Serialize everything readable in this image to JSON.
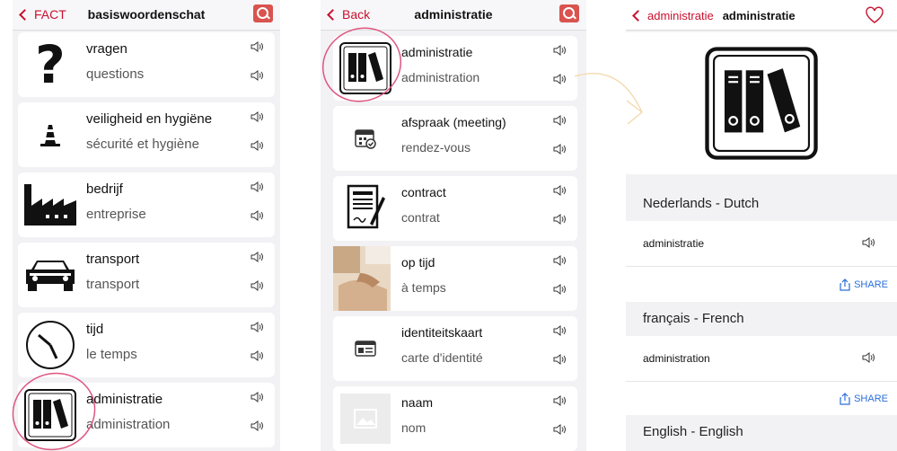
{
  "screen1": {
    "back_label": "FACT",
    "title": "basiswoordenschat",
    "items": [
      {
        "word": "vragen",
        "translation": "questions",
        "icon": "question-mark-icon"
      },
      {
        "word": "veiligheid en hygiëne",
        "translation": "sécurité et hygiène",
        "icon": "traffic-cone-icon"
      },
      {
        "word": "bedrijf",
        "translation": "entreprise",
        "icon": "factory-icon"
      },
      {
        "word": "transport",
        "translation": "transport",
        "icon": "car-icon"
      },
      {
        "word": "tijd",
        "translation": "le temps",
        "icon": "clock-icon"
      },
      {
        "word": "administratie",
        "translation": "administration",
        "icon": "binders-icon"
      }
    ]
  },
  "screen2": {
    "back_label": "Back",
    "title": "administratie",
    "items": [
      {
        "word": "administratie",
        "translation": "administration",
        "icon": "binders-icon"
      },
      {
        "word": "afspraak (meeting)",
        "translation": "rendez-vous",
        "icon": "calendar-icon"
      },
      {
        "word": "contract",
        "translation": "contrat",
        "icon": "contract-icon"
      },
      {
        "word": "op tijd",
        "translation": "à temps",
        "icon": "photo-handshake-icon"
      },
      {
        "word": "identiteitskaart",
        "translation": "carte d'identité",
        "icon": "id-card-icon"
      },
      {
        "word": "naam",
        "translation": "nom",
        "icon": "image-placeholder-icon"
      }
    ]
  },
  "screen3": {
    "back_label": "administratie",
    "title": "administratie",
    "sections": [
      {
        "header": "Nederlands - Dutch",
        "word": "administratie",
        "share_label": "SHARE"
      },
      {
        "header": "français - French",
        "word": "administration",
        "share_label": "SHARE"
      },
      {
        "header": "English - English"
      }
    ]
  },
  "colors": {
    "accent": "#c8102e",
    "link_blue": "#2a6fdb",
    "highlight_circle": "#e0557f",
    "arrow": "#f3d6a8"
  }
}
